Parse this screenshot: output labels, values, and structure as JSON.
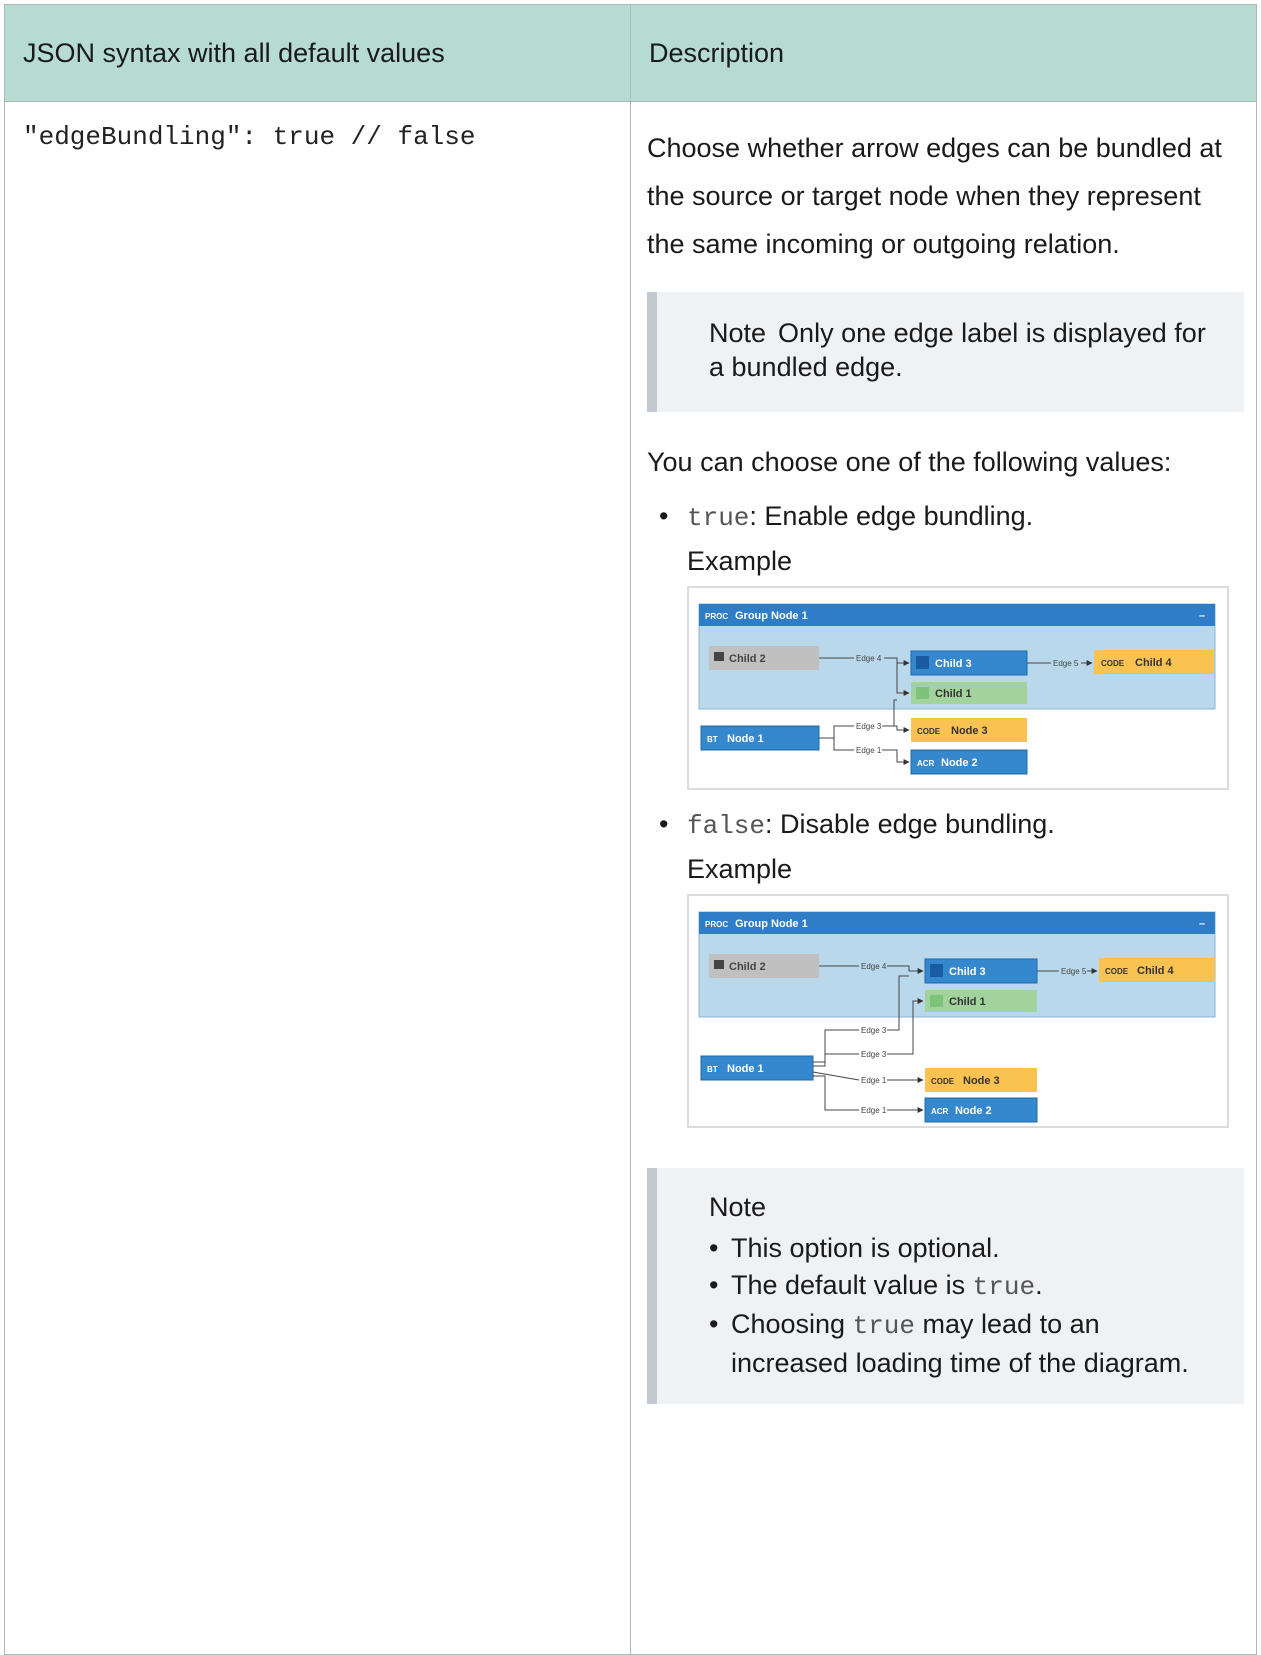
{
  "table": {
    "headers": [
      "JSON syntax with all default values",
      "Description"
    ]
  },
  "row": {
    "syntax": "\"edgeBundling\": true // false",
    "description": "Choose whether arrow edges can be bundled at the source or target node when they represent the same incoming or outgoing relation.",
    "note1": {
      "title": "Note",
      "text": "Only one edge label is displayed for a bundled edge."
    },
    "choose_text": "You can choose one of the following values:",
    "options": [
      {
        "value": "true",
        "text": ": Enable edge bundling.",
        "example_label": "Example"
      },
      {
        "value": "false",
        "text": ": Disable edge bundling.",
        "example_label": "Example"
      }
    ],
    "note2": {
      "title": "Note",
      "items": [
        {
          "text": "This option is optional."
        },
        {
          "pre": "The default value is ",
          "code": "true",
          "post": "."
        },
        {
          "pre": "Choosing ",
          "code": "true",
          "post": " may lead to an increased loading time of the diagram."
        }
      ]
    }
  },
  "diagram": {
    "group_tag": "PROC",
    "group_title": "Group Node 1",
    "collapse_symbol": "–",
    "nodes": {
      "child2": "Child 2",
      "child3": "Child 3",
      "child1": "Child 1",
      "child4": "Child 4",
      "node1": "Node 1",
      "node3": "Node 3",
      "node2": "Node 2"
    },
    "tags": {
      "code": "CODE",
      "bt": "BT",
      "acr": "ACR"
    },
    "edges": {
      "e4": "Edge 4",
      "e5": "Edge 5",
      "e3": "Edge 3",
      "e1": "Edge 1"
    },
    "colors": {
      "group_header": "#2e7dc6",
      "group_body": "#bad8ec",
      "blue_node": "#3588ce",
      "orange_node": "#f9c251",
      "green_node": "#a3d39c",
      "gray_node": "#c0c0c0"
    }
  }
}
